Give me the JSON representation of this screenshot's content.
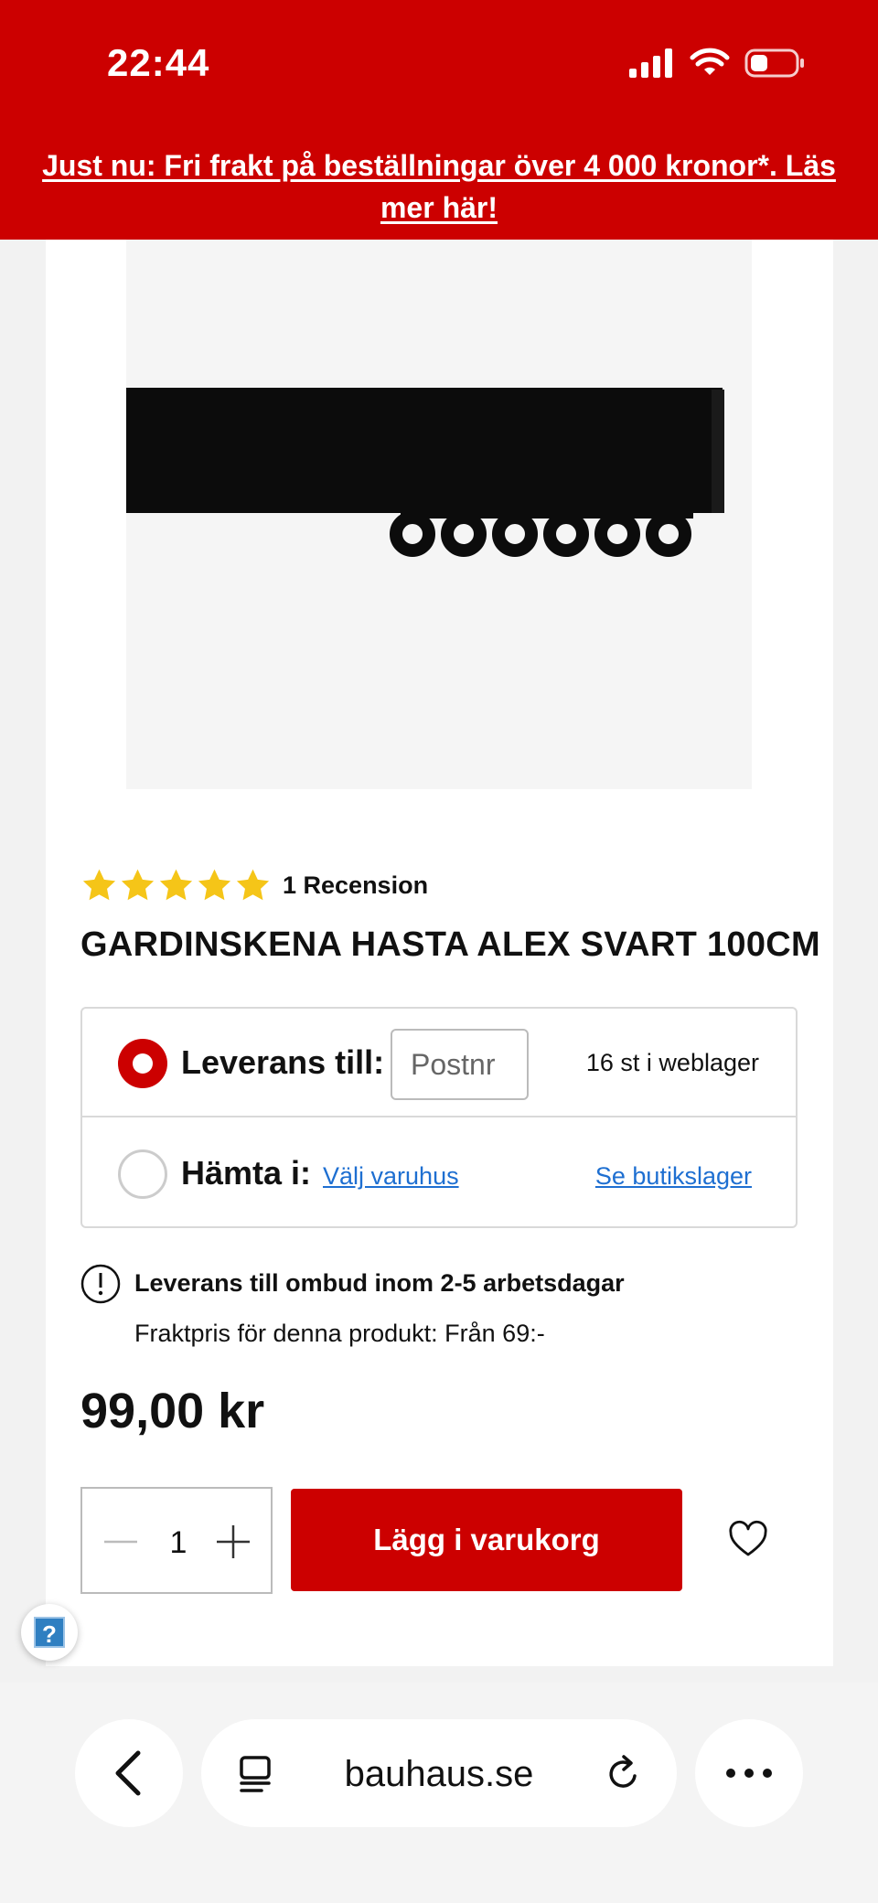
{
  "status_bar": {
    "time": "22:44"
  },
  "banner": {
    "line1": "Just nu: Fri frakt på beställningar över 4 000 kronor*. Läs",
    "line2": "mer här!"
  },
  "product": {
    "rating_stars": 5,
    "rating_text": "1 Recension",
    "title": "GARDINSKENA HASTA ALEX SVART 100CM",
    "price": "99,00 kr"
  },
  "delivery": {
    "delivery_label": "Leverans till:",
    "postnr_placeholder": "Postnr",
    "stock_text": "16 st i weblager",
    "pickup_label": "Hämta i:",
    "choose_store": "Välj varuhus",
    "store_stock": "Se butikslager"
  },
  "notice": {
    "title": "Leverans till ombud inom 2-5 arbetsdagar",
    "subtitle": "Fraktpris för denna produkt: Från 69:-"
  },
  "cart": {
    "quantity": "1",
    "add_button": "Lägg i varukorg"
  },
  "browser": {
    "url": "bauhaus.se"
  },
  "colors": {
    "brand_red": "#cc0000",
    "link_blue": "#1e6fd1",
    "star_yellow": "#f5c518"
  }
}
